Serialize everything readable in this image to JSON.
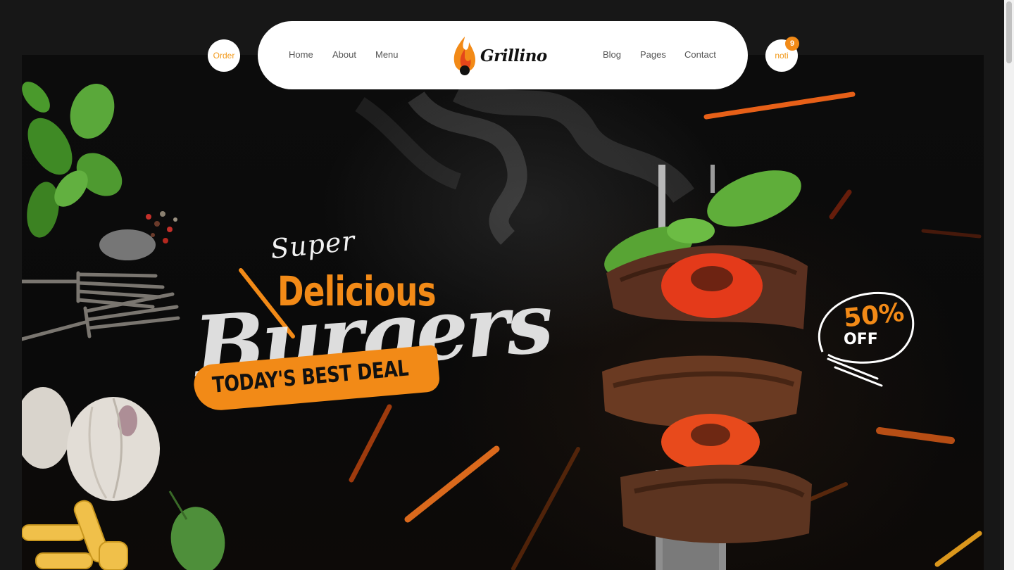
{
  "nav": {
    "left_links": [
      "Home",
      "About",
      "Menu"
    ],
    "right_links": [
      "Blog",
      "Pages",
      "Contact"
    ],
    "logo_text": "Grillino"
  },
  "order_button": {
    "label": "Order"
  },
  "noti_button": {
    "label": "noti",
    "count": "9"
  },
  "hero": {
    "super": "Super",
    "delicious": "Delicious",
    "burgers": "Burgers",
    "deal": "TODAY'S BEST DEAL",
    "off_pct": "50%",
    "off_word": "OFF"
  },
  "colors": {
    "accent": "#f28a17",
    "background": "#171717",
    "nav_bg": "#ffffff"
  },
  "icons": [
    "flame-logo-icon"
  ]
}
